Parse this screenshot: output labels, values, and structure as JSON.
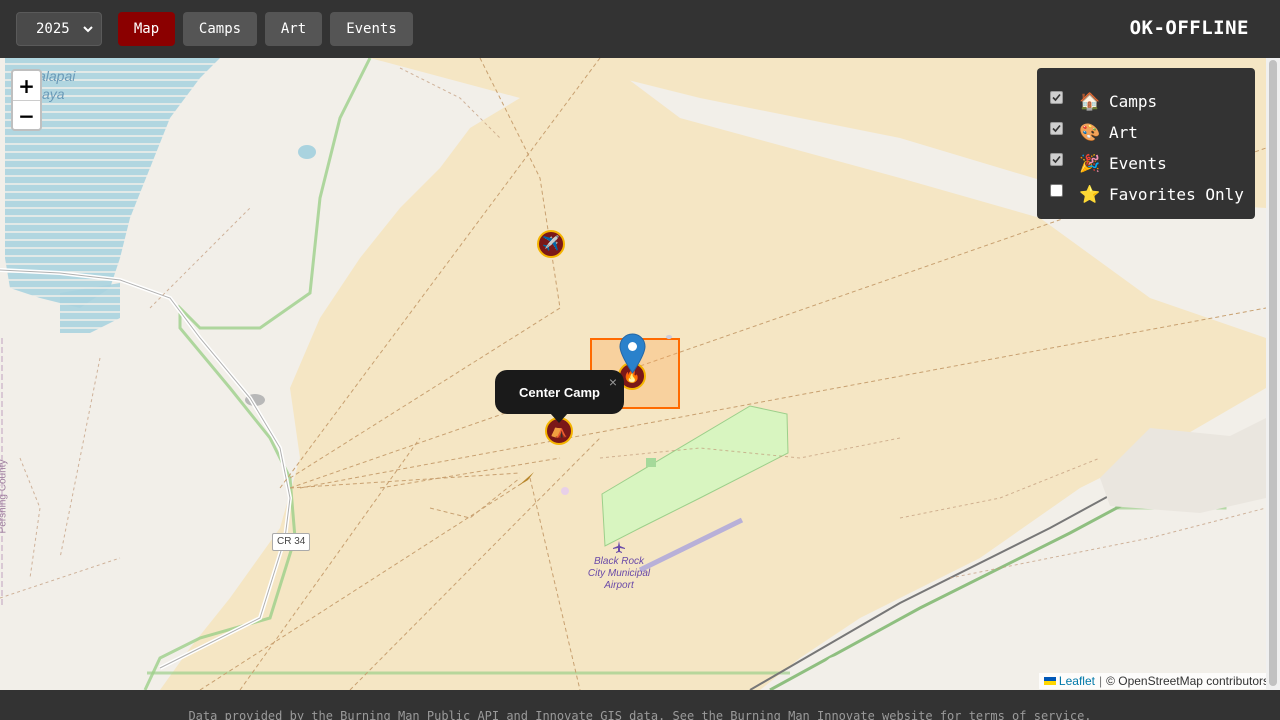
{
  "header": {
    "year_selected": "2025",
    "nav": [
      "Map",
      "Camps",
      "Art",
      "Events"
    ],
    "active_nav": "Map",
    "brand": "OK-OFFLINE"
  },
  "map": {
    "zoom_in_label": "+",
    "zoom_out_label": "−",
    "labels": {
      "playa_line1": "alapai",
      "playa_line2": "aya",
      "county": "Pershing County",
      "road": "CR 34",
      "airport_line1": "Black Rock",
      "airport_line2": "City Municipal",
      "airport_line3": "Airport"
    },
    "popup": {
      "title": "Center Camp",
      "close": "×"
    },
    "markers": [
      "plane-marker",
      "fire-marker",
      "camp-marker"
    ]
  },
  "layers": [
    {
      "label": "Camps",
      "emoji": "🏠",
      "checked": true
    },
    {
      "label": "Art",
      "emoji": "🎨",
      "checked": true
    },
    {
      "label": "Events",
      "emoji": "🎉",
      "checked": true
    },
    {
      "label": "Favorites Only",
      "emoji": "⭐",
      "checked": false
    }
  ],
  "attribution": {
    "leaflet": "Leaflet",
    "separator": "|",
    "osm": "© OpenStreetMap contributors"
  },
  "footer": {
    "text": "Data provided by the Burning Man Public API and Innovate GIS data. See the Burning Man Innovate website for terms of service."
  },
  "colors": {
    "header_bg": "#333333",
    "active_button": "#8b0000",
    "button": "#555555",
    "playa": "#f5e6c4",
    "water": "#aad3df",
    "park": "#d8f5c0"
  }
}
